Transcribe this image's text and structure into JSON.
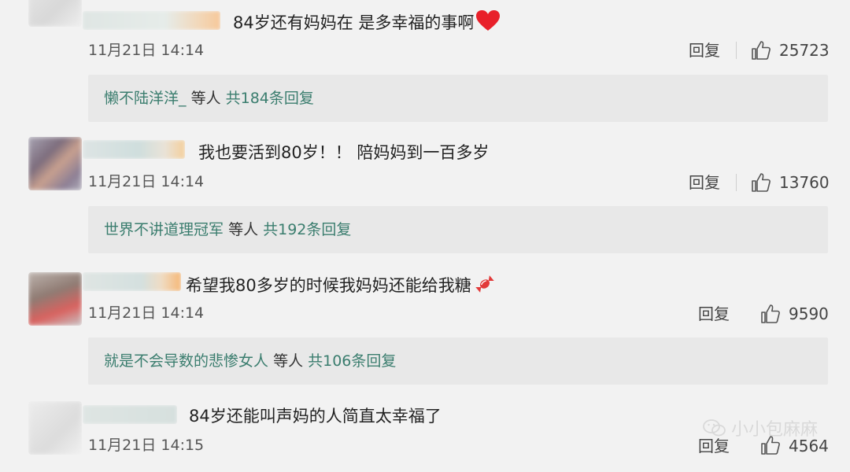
{
  "comments": [
    {
      "text": "84岁还有妈妈在 是多幸福的事啊",
      "emoji": "heart-icon",
      "time": "11月21日 14:14",
      "reply_label": "回复",
      "likes": "25723",
      "replies": {
        "users": "懒不陆洋洋_",
        "others": "等人",
        "total": "共184条回复"
      }
    },
    {
      "text": "我也要活到80岁！！ 陪妈妈到一百多岁",
      "time": "11月21日 14:14",
      "reply_label": "回复",
      "likes": "13760",
      "replies": {
        "users": "世界不讲道理冠军",
        "others": "等人",
        "total": "共192条回复"
      }
    },
    {
      "text": "希望我80多岁的时候我妈妈还能给我糖",
      "emoji": "candy-icon",
      "time": "11月21日 14:14",
      "reply_label": "回复",
      "likes": "9590",
      "replies": {
        "users": "就是不会导数的悲惨女人",
        "others": "等人",
        "total": "共106条回复"
      }
    },
    {
      "text": "84岁还能叫声妈的人简直太幸福了",
      "time": "11月21日 14:15",
      "reply_label": "回复",
      "likes": "4564"
    }
  ],
  "watermark": "小小包麻麻",
  "colors": {
    "link": "#3a7d6e",
    "heart": "#e8202a",
    "background": "#f2f2f2"
  }
}
